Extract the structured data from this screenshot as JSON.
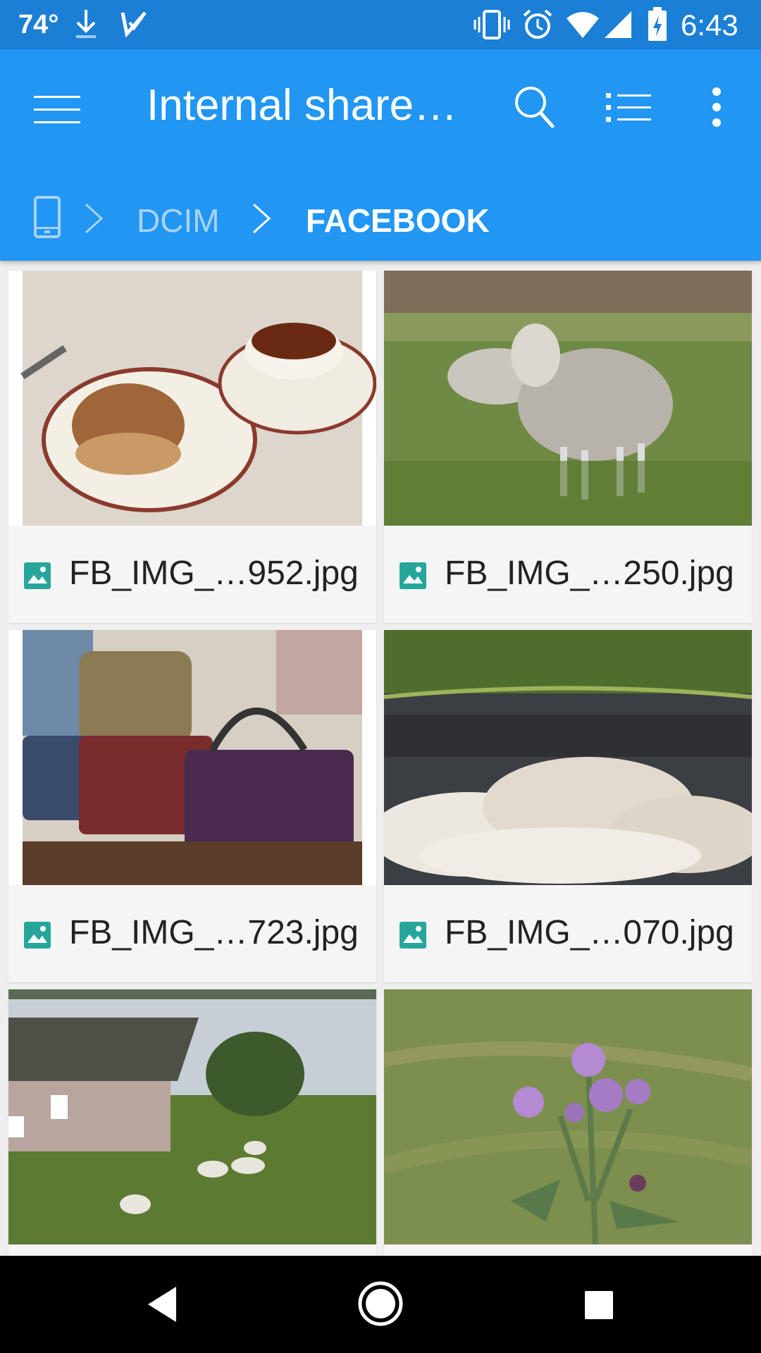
{
  "status_bar": {
    "temperature": "74°",
    "time": "6:43",
    "icons": [
      "download-icon",
      "check-icon",
      "vibrate-icon",
      "alarm-icon",
      "wifi-icon",
      "signal-icon",
      "battery-charging-icon"
    ]
  },
  "app_bar": {
    "title": "Internal share…",
    "icons": [
      "menu-icon",
      "search-icon",
      "list-view-icon",
      "more-vert-icon"
    ]
  },
  "breadcrumb": {
    "items": [
      "DCIM",
      "FACEBOOK"
    ]
  },
  "files": [
    {
      "name": "FB_IMG_…952.jpg",
      "thumb": "scone and tea"
    },
    {
      "name": "FB_IMG_…250.jpg",
      "thumb": "sheep on grass"
    },
    {
      "name": "FB_IMG_…723.jpg",
      "thumb": "tweed bags"
    },
    {
      "name": "FB_IMG_…070.jpg",
      "thumb": "wool fleece"
    },
    {
      "name": "",
      "thumb": "cottage with sheep"
    },
    {
      "name": "",
      "thumb": "thistle flower"
    }
  ],
  "nav_bar": {
    "icons": [
      "back-icon",
      "home-icon",
      "recents-icon"
    ]
  },
  "colors": {
    "primary": "#2196f3",
    "status_bar": "#1b7fd6",
    "image_icon": "#26a69a"
  }
}
